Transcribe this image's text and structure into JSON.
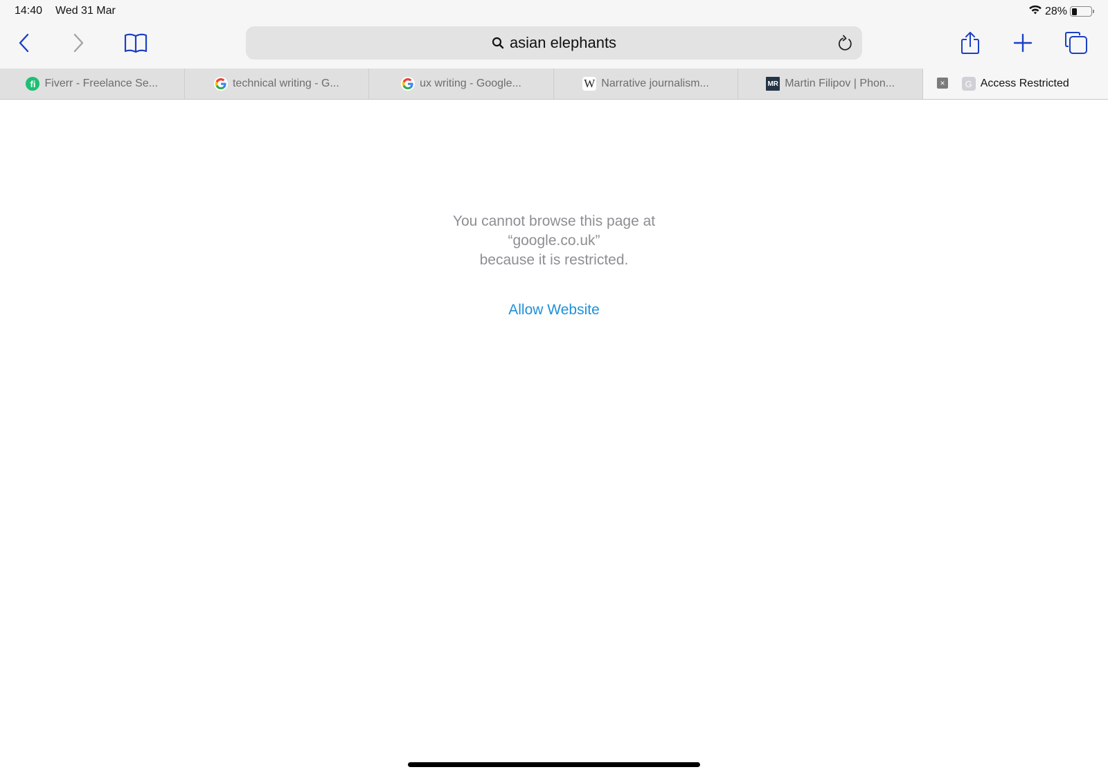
{
  "status_bar": {
    "time": "14:40",
    "date": "Wed 31 Mar",
    "battery_percent_label": "28%",
    "battery_level": 0.28
  },
  "toolbar": {
    "back_icon": "chevron-left-icon",
    "forward_icon": "chevron-right-icon",
    "bookmarks_icon": "book-icon",
    "share_icon": "share-icon",
    "new_tab_icon": "plus-icon",
    "tabs_icon": "tabs-overview-icon",
    "accent_color": "#1a3fc4"
  },
  "address_bar": {
    "search_icon": "magnifier-icon",
    "value": "asian elephants",
    "reload_icon": "reload-icon"
  },
  "tabs": [
    {
      "title": "Fiverr - Freelance Se...",
      "favicon": "fiverr-favicon",
      "favicon_text": "fi",
      "active": false
    },
    {
      "title": "technical writing - G...",
      "favicon": "google-favicon",
      "favicon_text": "G",
      "active": false
    },
    {
      "title": "ux writing - Google...",
      "favicon": "google-favicon",
      "favicon_text": "G",
      "active": false
    },
    {
      "title": "Narrative journalism...",
      "favicon": "wikipedia-favicon",
      "favicon_text": "W",
      "active": false
    },
    {
      "title": "Martin Filipov | Phon...",
      "favicon": "mr-favicon",
      "favicon_text": "MR",
      "active": false
    },
    {
      "title": "Access Restricted",
      "favicon": "generic-g-favicon",
      "favicon_text": "G",
      "active": true,
      "close_label": "×"
    }
  ],
  "page": {
    "message_line1": "You cannot browse this page at",
    "message_line2": "“google.co.uk”",
    "message_line3": "because it is restricted.",
    "allow_button": "Allow Website",
    "link_color": "#1e90d8"
  }
}
